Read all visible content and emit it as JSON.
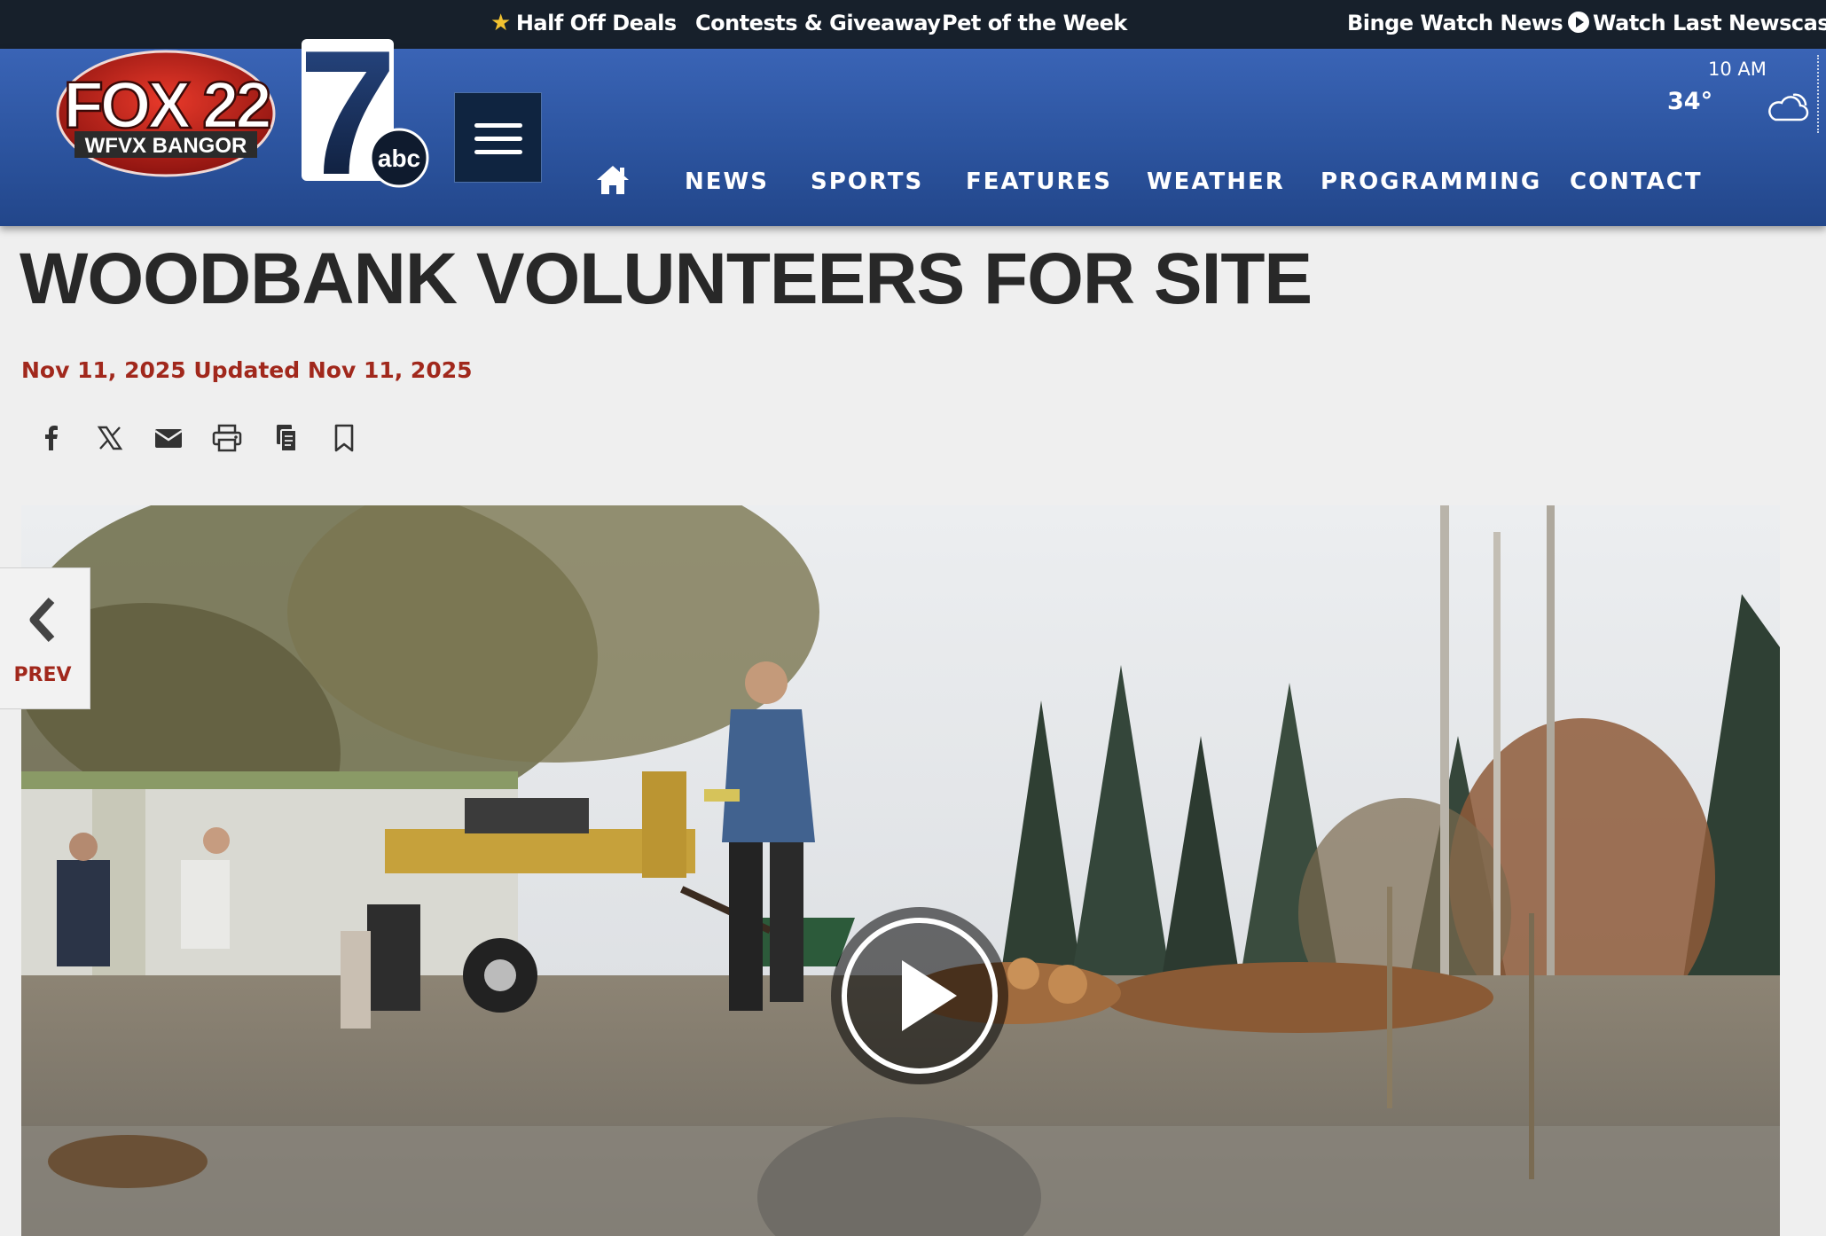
{
  "topbar": {
    "deals": "Half Off Deals",
    "contests": "Contests & Giveaway",
    "pet": "Pet of the Week",
    "binge": "Binge Watch News",
    "watch_last": "Watch Last Newscast"
  },
  "logos": {
    "fox_text": "FOX 22",
    "fox_sub": "WFVX BANGOR",
    "abc_number": "7",
    "abc_text": "abc"
  },
  "nav": {
    "items": [
      "NEWS",
      "SPORTS",
      "FEATURES",
      "WEATHER",
      "PROGRAMMING",
      "CONTACT"
    ]
  },
  "weather": {
    "time": "10 AM",
    "temp": "34°",
    "icon": "cloud-icon"
  },
  "article": {
    "headline": "WOODBANK VOLUNTEERS FOR SITE",
    "dateline": "Nov 11, 2025 Updated Nov 11, 2025"
  },
  "share_icons": [
    "facebook-icon",
    "x-icon",
    "email-icon",
    "print-icon",
    "copy-icon",
    "bookmark-icon"
  ],
  "carousel": {
    "prev_label": "PREV"
  },
  "colors": {
    "topbar_bg": "#17202b",
    "header_blue": "#2c549f",
    "accent_red": "#a1281c",
    "headline": "#282828",
    "star": "#f2c230"
  }
}
